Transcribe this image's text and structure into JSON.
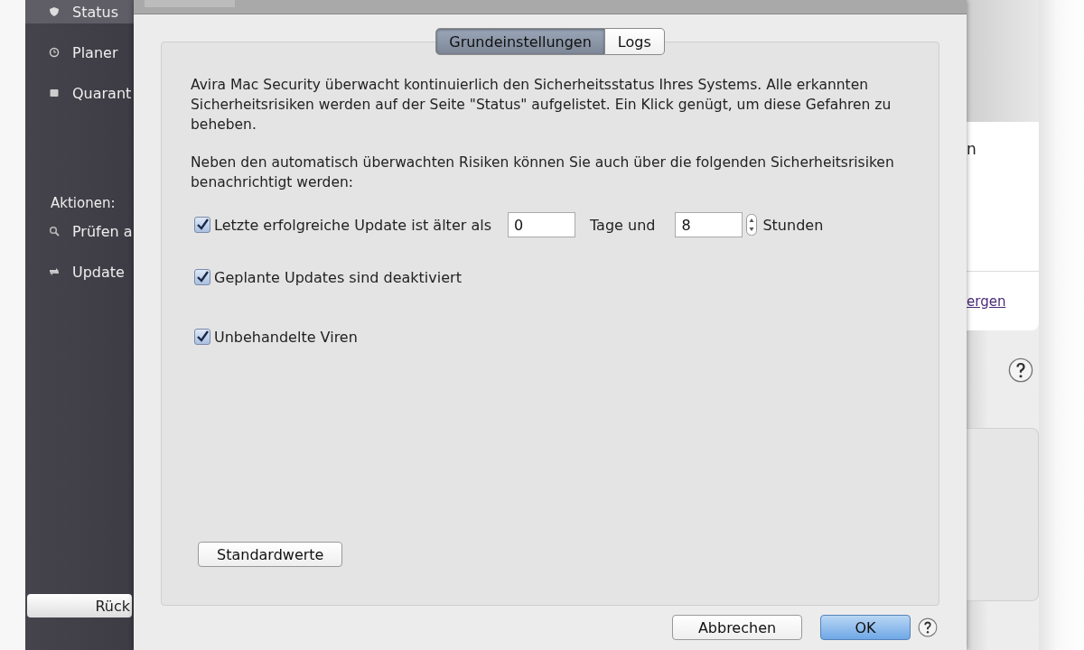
{
  "sidebar": {
    "items": [
      {
        "label": "Status",
        "selected": true
      },
      {
        "label": "Planer",
        "selected": false
      },
      {
        "label": "Quarant",
        "selected": false
      }
    ],
    "actions_heading": "Aktionen:",
    "actions": [
      {
        "label": "Prüfen a"
      },
      {
        "label": "Update"
      }
    ],
    "back_button": "Rück"
  },
  "dialog": {
    "tabs": [
      {
        "label": "Grundeinstellungen",
        "selected": true
      },
      {
        "label": "Logs",
        "selected": false
      }
    ],
    "intro": "Avira Mac Security überwacht kontinuierlich den Sicherheitsstatus Ihres Systems. Alle erkannten Sicherheitsrisiken werden auf der Seite \"Status\" aufgelistet. Ein Klick genügt, um diese Gefahren zu beheben.",
    "note": "Neben den automatisch überwachten Risiken können Sie auch über die folgenden Sicherheitsrisiken benachrichtigt werden:",
    "options": [
      {
        "label": "Letzte erfolgreiche Update ist älter als",
        "checked": true,
        "days_value": "0",
        "days_label": "Tage und",
        "hours_value": "8",
        "hours_label": "Stunden"
      },
      {
        "label": "Geplante Updates sind deaktiviert",
        "checked": true
      },
      {
        "label": "Unbehandelte Viren",
        "checked": true
      }
    ],
    "defaults_button": "Standardwerte",
    "buttons": [
      "Abbrechen",
      "OK"
    ]
  },
  "right_pane": {
    "text_fragment": "n",
    "link_fragment": "ergen"
  }
}
